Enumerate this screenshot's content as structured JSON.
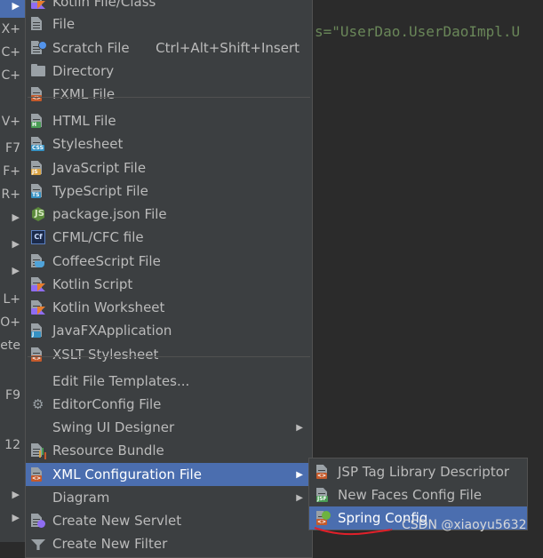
{
  "parent_menu": {
    "rows": [
      {
        "text": "▶",
        "arrow": true,
        "active": true
      },
      {
        "text": "+X"
      },
      {
        "text": "+C"
      },
      {
        "text": "+C"
      },
      {
        "text": "+V"
      },
      {
        "text": "F7"
      },
      {
        "text": "+F"
      },
      {
        "text": "+R"
      },
      {
        "text": "▶",
        "arrow": true
      },
      {
        "text": "▶",
        "arrow": true
      },
      {
        "text": "▶",
        "arrow": true
      },
      {
        "text": "+L"
      },
      {
        "text": "+O"
      },
      {
        "text": "ete"
      },
      {
        "text": "F9"
      },
      {
        "text": "12"
      },
      {
        "text": "▶",
        "arrow": true
      },
      {
        "text": "▶",
        "arrow": true
      }
    ]
  },
  "editor": {
    "visible_code": "s=\"UserDao.UserDaoImpl.U"
  },
  "menu": {
    "items": [
      {
        "label": "Kotlin File/Class",
        "icon": "kotlin-file-icon"
      },
      {
        "label": "File",
        "icon": "file-icon"
      },
      {
        "label": "Scratch File",
        "shortcut": "Ctrl+Alt+Shift+Insert",
        "icon": "scratch-file-icon"
      },
      {
        "label": "Directory",
        "icon": "folder-icon"
      },
      {
        "label": "FXML File",
        "icon": "fxml-file-icon"
      },
      {
        "label": "HTML File",
        "icon": "html-file-icon"
      },
      {
        "label": "Stylesheet",
        "icon": "css-file-icon"
      },
      {
        "label": "JavaScript File",
        "icon": "js-file-icon"
      },
      {
        "label": "TypeScript File",
        "icon": "ts-file-icon"
      },
      {
        "label": "package.json File",
        "icon": "nodejs-icon"
      },
      {
        "label": "CFML/CFC file",
        "icon": "cf-file-icon"
      },
      {
        "label": "CoffeeScript File",
        "icon": "coffee-file-icon"
      },
      {
        "label": "Kotlin Script",
        "icon": "kotlin-script-icon"
      },
      {
        "label": "Kotlin Worksheet",
        "icon": "kotlin-worksheet-icon"
      },
      {
        "label": "JavaFXApplication",
        "icon": "javafx-file-icon"
      },
      {
        "label": "XSLT Stylesheet",
        "icon": "xslt-file-icon"
      },
      {
        "label": "Edit File Templates...",
        "icon": ""
      },
      {
        "label": "EditorConfig File",
        "icon": "gear-icon"
      },
      {
        "label": "Swing UI Designer",
        "icon": "",
        "submenu": true
      },
      {
        "label": "Resource Bundle",
        "icon": "resource-bundle-icon"
      },
      {
        "label": "XML Configuration File",
        "icon": "xml-file-icon",
        "submenu": true,
        "active": true
      },
      {
        "label": "Diagram",
        "icon": "",
        "submenu": true
      },
      {
        "label": "Create New Servlet",
        "icon": "servlet-icon"
      },
      {
        "label": "Create New Filter",
        "icon": "filter-icon"
      }
    ]
  },
  "xml_submenu": {
    "items": [
      {
        "label": "JSP Tag Library Descriptor",
        "icon": "tld-file-icon"
      },
      {
        "label": "New Faces Config File",
        "icon": "jsf-file-icon"
      },
      {
        "label": "Spring Config",
        "icon": "spring-file-icon",
        "active": true
      }
    ]
  },
  "watermark": "CSDN @xiaoyu5632",
  "colors": {
    "accent": "#4b6eaf",
    "menu_bg": "#3c3f41",
    "editor_bg": "#2b2b2b",
    "string_green": "#6a8759"
  }
}
